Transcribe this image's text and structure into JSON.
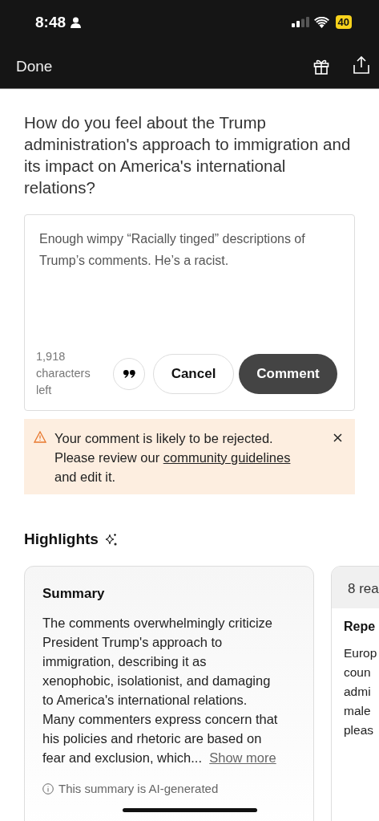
{
  "status_bar": {
    "time": "8:48",
    "battery": "40"
  },
  "nav": {
    "done": "Done"
  },
  "question": "How do you feel about the Trump administration's approach to immigration and its impact on America's international relations?",
  "composer": {
    "value": "Enough wimpy “Racially tinged” descriptions of Trump’s comments.  He’s a racist.",
    "count": "1,918",
    "count_label": "characters left",
    "cancel": "Cancel",
    "submit": "Comment"
  },
  "warning": {
    "before": "Your comment is likely to be rejected. Please review our ",
    "link": "community guidelines",
    "after": " and edit it."
  },
  "highlights": {
    "title": "Highlights",
    "cards": [
      {
        "kind": "summary",
        "title": "Summary",
        "body": "The comments overwhelmingly criticize President Trump's approach to immigration, describing it as xenophobic, isolationist, and damaging to America's international relations. Many commenters express concern that his policies and rhetoric are based on fear and exclusion, which...",
        "more": "Show more",
        "note": "This summary is AI-generated"
      },
      {
        "kind": "partial",
        "header": "8 rea",
        "title": "Repe",
        "lines": [
          "Europ",
          "coun",
          "admi",
          "male",
          "pleas"
        ]
      }
    ]
  }
}
